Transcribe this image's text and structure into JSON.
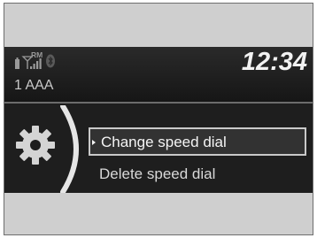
{
  "status_bar": {
    "clock": "12:34",
    "roaming_indicator": "RM",
    "icons": [
      "phone-battery-icon",
      "signal-strength-icon",
      "bluetooth-icon"
    ]
  },
  "phone_label": "1 AAA",
  "settings_icon": "gear-icon",
  "menu": {
    "items": [
      {
        "label": "Change speed dial",
        "selected": true
      },
      {
        "label": "Delete speed dial",
        "selected": false
      }
    ]
  },
  "colors": {
    "screen_background": "#1e1e1e",
    "text": "#d8d8d8",
    "highlight_border": "#c9c9c9"
  }
}
